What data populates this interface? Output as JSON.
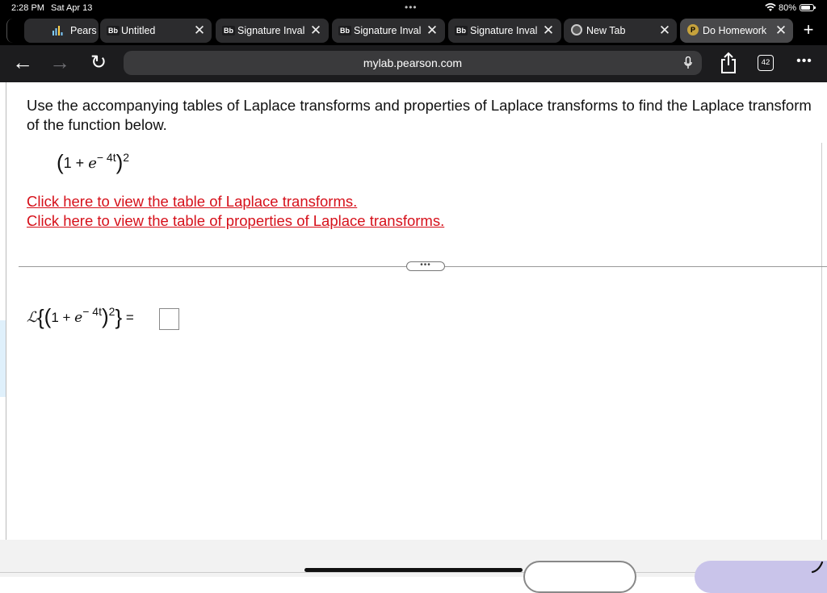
{
  "status_bar": {
    "time": "2:28 PM",
    "date": "Sat Apr 13",
    "battery": "80%",
    "more_dots": "•••"
  },
  "tabs": [
    {
      "label": "Pearson's I",
      "favicon": "bar-chart-icon"
    },
    {
      "label": "Untitled",
      "favicon": "bb-icon"
    },
    {
      "label": "Signature Inval",
      "favicon": "bb-icon"
    },
    {
      "label": "Signature Inval",
      "favicon": "bb-icon"
    },
    {
      "label": "Signature Inval",
      "favicon": "bb-icon"
    },
    {
      "label": "New Tab",
      "favicon": "globe-icon"
    },
    {
      "label": "Do Homework",
      "favicon": "pearson-p-icon",
      "active": true
    }
  ],
  "favicon_text": {
    "bb": "Bb",
    "p": "P"
  },
  "tab_close_glyph": "✕",
  "new_tab_glyph": "+",
  "toolbar": {
    "url": "mylab.pearson.com",
    "tab_count": "42",
    "more": "•••"
  },
  "question": {
    "text": "Use the accompanying tables of Laplace transforms and properties of Laplace transforms to find the Laplace transform of the function below.",
    "function": {
      "open": "(",
      "one_plus": "1 + ",
      "base": "e",
      "exponent": "− 4t",
      "close": ")",
      "power": "2"
    },
    "links": [
      "Click here to view the table of Laplace transforms.",
      "Click here to view the table of properties of Laplace transforms."
    ]
  },
  "expand_pill": "•••",
  "answer": {
    "laplace": "ℒ",
    "open_brace": "{",
    "close_brace": "}",
    "equals": "=",
    "value": ""
  },
  "colors": {
    "link": "#d6101a",
    "chrome_bg": "#1c1c1e",
    "tab_bg": "#2c2c2e",
    "active_tab_bg": "#48484a",
    "check_answer_bg": "#c9c4ea"
  }
}
